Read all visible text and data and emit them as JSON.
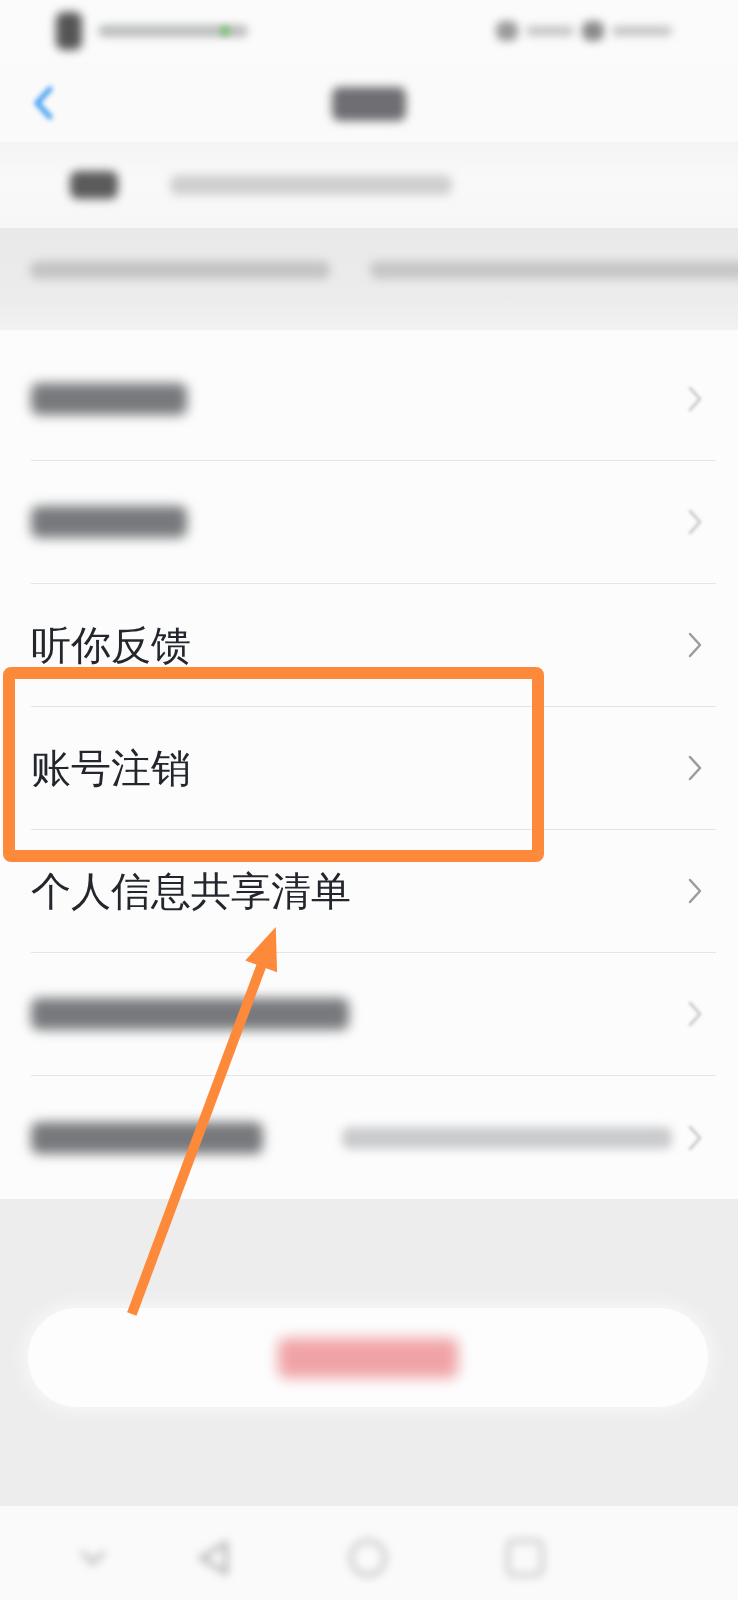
{
  "status_bar": {
    "blurred": true
  },
  "nav_bar": {
    "back_button": true,
    "title_blurred": true
  },
  "account_row": {
    "blurred": true
  },
  "notice": {
    "blurred": true
  },
  "settings_list": [
    {
      "kind": "blurred",
      "highlighted": false,
      "arrow_target": false
    },
    {
      "kind": "blurred",
      "highlighted": false,
      "arrow_target": false
    },
    {
      "kind": "text",
      "label": "听你反馈",
      "highlighted": false,
      "arrow_target": false
    },
    {
      "kind": "text",
      "label": "账号注销",
      "highlighted": true,
      "arrow_target": false
    },
    {
      "kind": "text",
      "label": "个人信息共享清单",
      "highlighted": false,
      "arrow_target": true
    },
    {
      "kind": "blurred",
      "highlighted": false,
      "arrow_target": false
    },
    {
      "kind": "blurred_with_value",
      "highlighted": false,
      "arrow_target": false
    }
  ],
  "logout_button": {
    "blurred": true
  },
  "system_nav": {
    "blurred": true
  }
}
